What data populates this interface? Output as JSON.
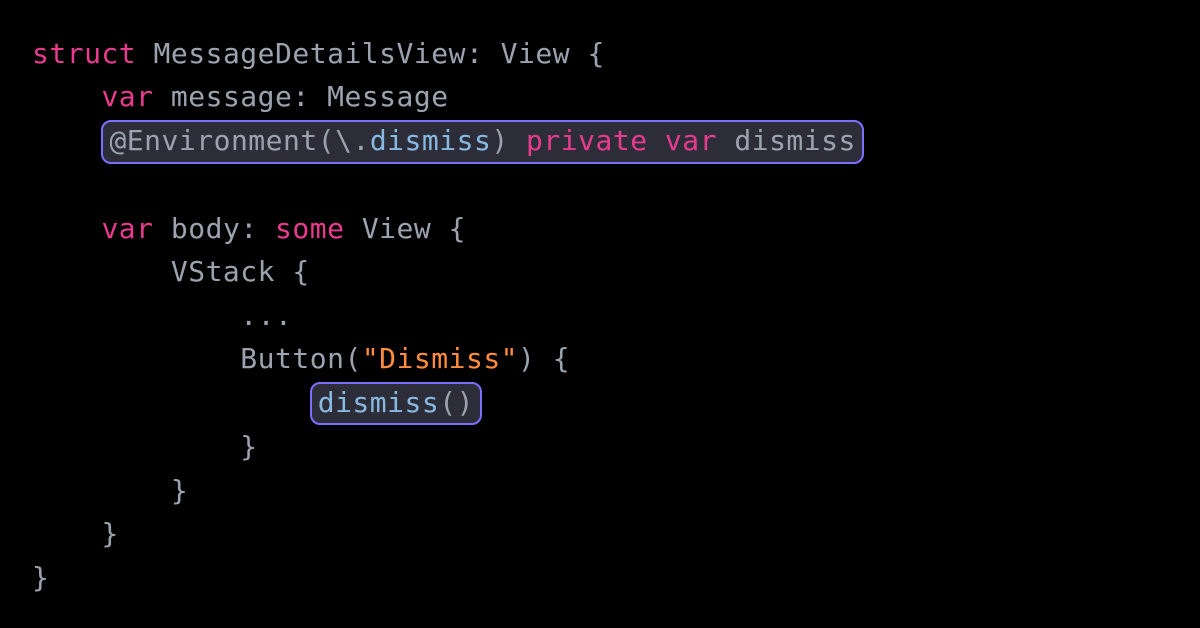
{
  "code": {
    "l1": {
      "kw": "struct",
      "name": "MessageDetailsView",
      "colon": ":",
      "proto": "View",
      "brace": "{"
    },
    "l2": {
      "kw": "var",
      "name": "message",
      "colon": ":",
      "type": "Message"
    },
    "l3": {
      "at": "@",
      "env": "Environment",
      "lp": "(",
      "bs": "\\",
      "dot": ".",
      "key": "dismiss",
      "rp": ")",
      "priv": "private",
      "kw": "var",
      "name": "dismiss"
    },
    "l4": {
      "kw": "var",
      "name": "body",
      "colon": ":",
      "some": "some",
      "type": "View",
      "brace": "{"
    },
    "l5": {
      "name": "VStack",
      "brace": "{"
    },
    "l6": {
      "dots": "..."
    },
    "l7": {
      "name": "Button",
      "lp": "(",
      "str": "\"Dismiss\"",
      "rp": ")",
      "brace": "{"
    },
    "l8": {
      "call": "dismiss",
      "lp": "(",
      "rp": ")"
    },
    "l9": {
      "brace": "}"
    },
    "l10": {
      "brace": "}"
    },
    "l11": {
      "brace": "}"
    },
    "l12": {
      "brace": "}"
    }
  }
}
